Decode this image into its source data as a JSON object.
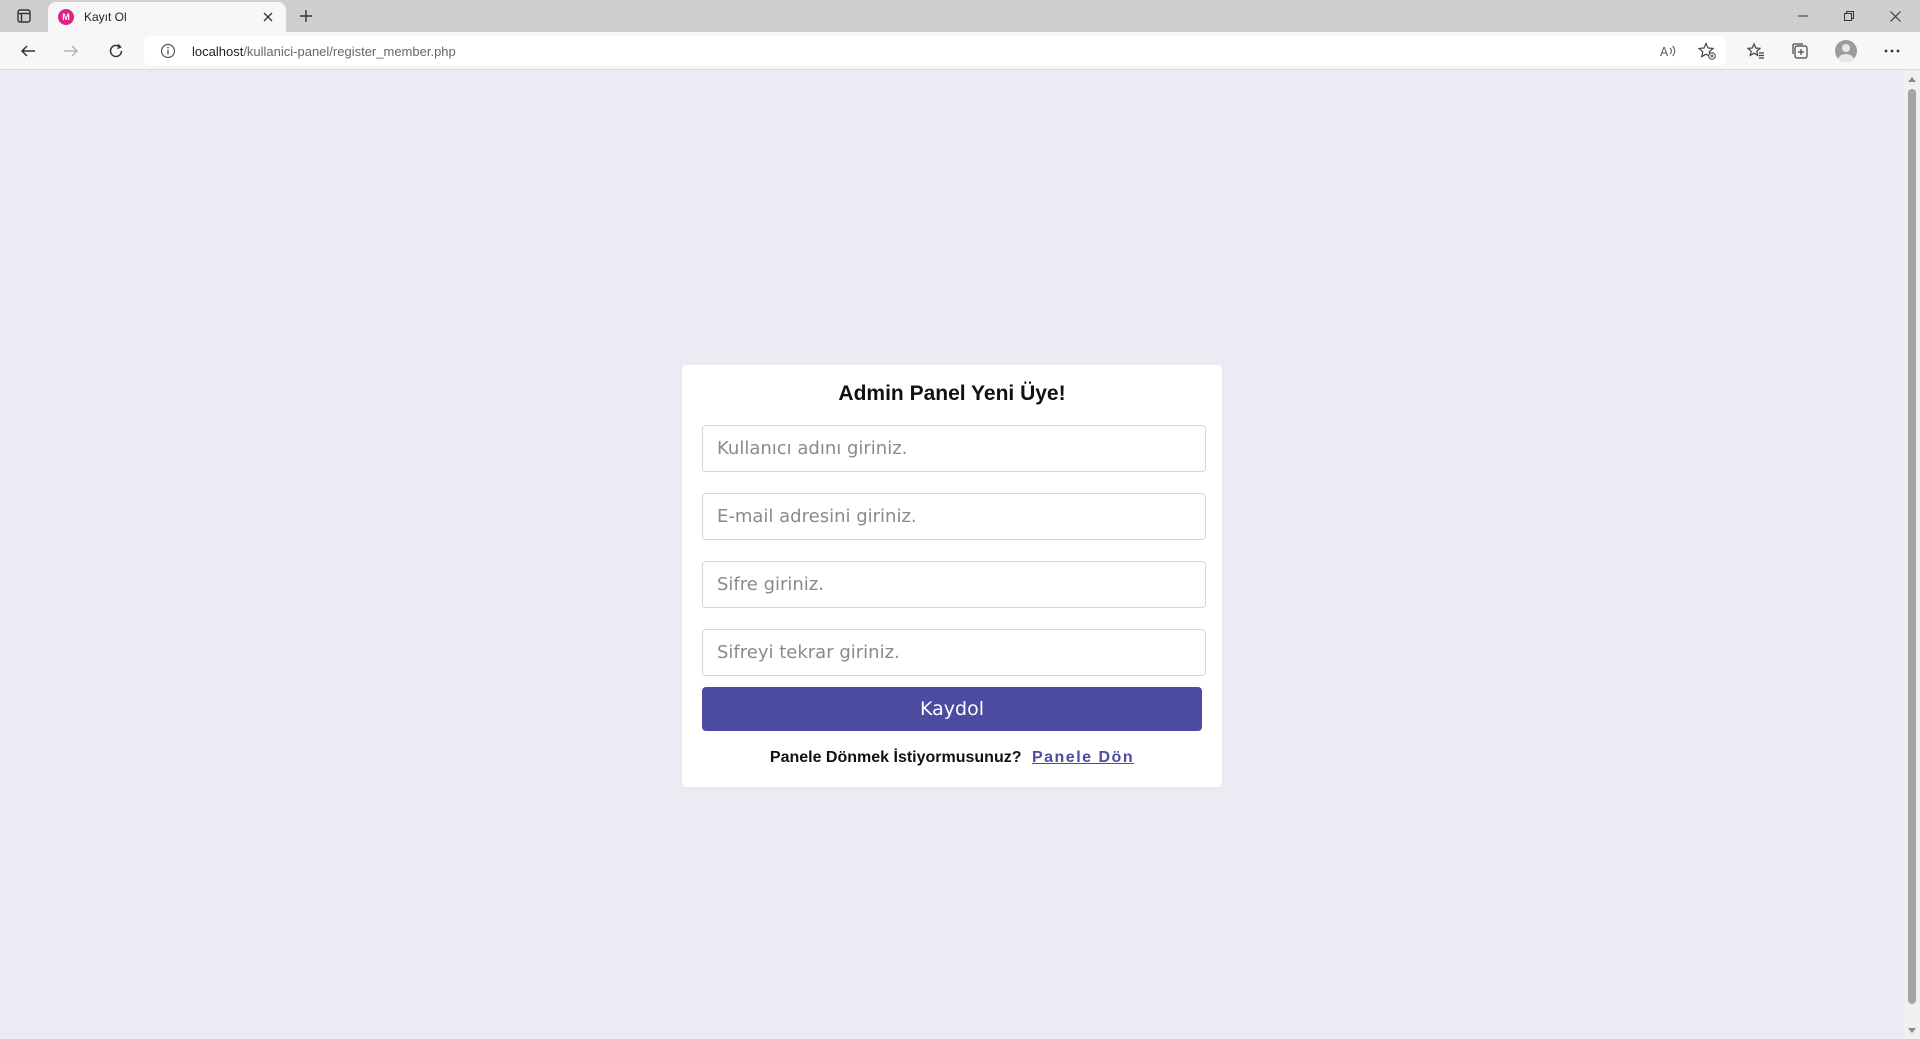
{
  "browser": {
    "tab": {
      "title": "Kayıt Ol",
      "favicon_icon": "browser-app-icon"
    },
    "address_bar": {
      "host": "localhost",
      "path": "/kullanici-panel/register_member.php"
    }
  },
  "form": {
    "title": "Admin Panel Yeni Üye!",
    "fields": [
      {
        "placeholder": "Kullanıcı adını giriniz.",
        "value": ""
      },
      {
        "placeholder": "E-mail adresini giriniz.",
        "value": ""
      },
      {
        "placeholder": "Sifre giriniz.",
        "value": ""
      },
      {
        "placeholder": "Sifreyi tekrar giriniz.",
        "value": ""
      }
    ],
    "submit_label": "Kaydol",
    "footer_text": "Panele Dönmek İstiyormusunuz?",
    "footer_link": "Panele Dön"
  },
  "colors": {
    "page_background": "#ebebf4",
    "accent": "#4b4ba0",
    "card_background": "#ffffff"
  }
}
